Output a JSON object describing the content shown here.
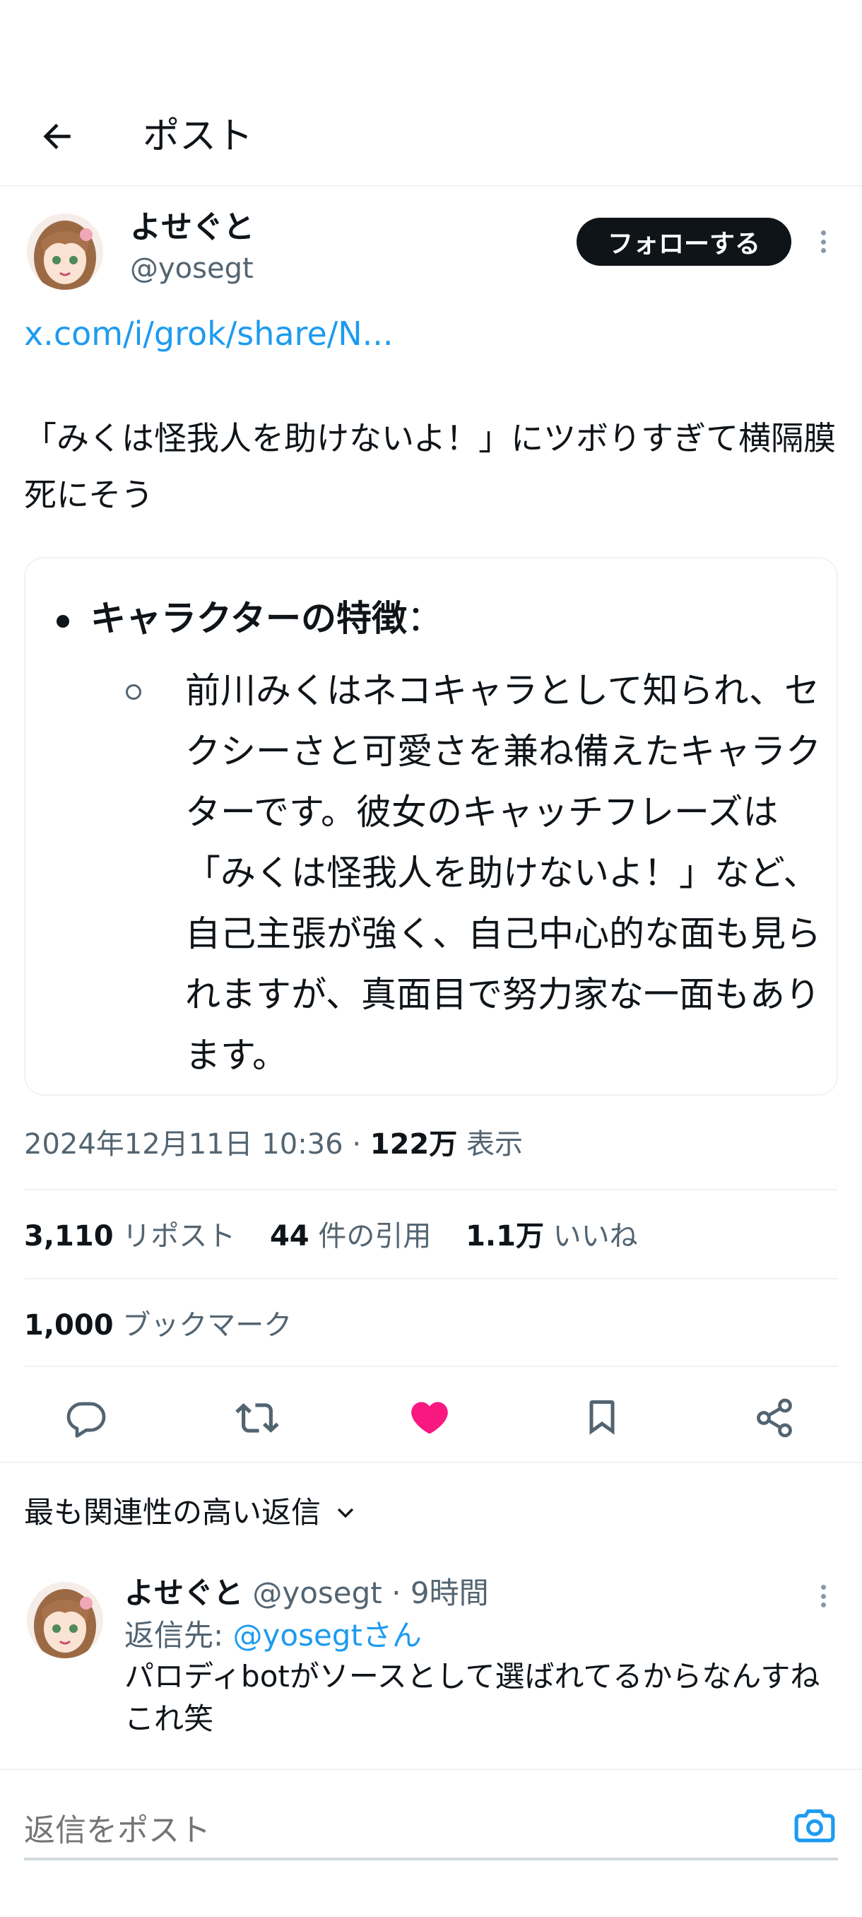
{
  "header": {
    "title": "ポスト"
  },
  "author": {
    "name": "よせぐと",
    "handle": "@yosegt",
    "follow_label": "フォローする"
  },
  "post": {
    "link": "x.com/i/grok/share/N...",
    "text": "「みくは怪我人を助けないよ！」にツボりすぎて横隔膜死にそう",
    "card": {
      "bullet_title": "キャラクターの特徴",
      "bullet_colon": "：",
      "sub_text": "前川みくはネコキャラとして知られ、セクシーさと可愛さを兼ね備えたキャラクターです。彼女のキャッチフレーズは「みくは怪我人を助けないよ！」など、自己主張が強く、自己中心的な面も見られますが、真面目で努力家な一面もあります。"
    },
    "timestamp": "2024年12月11日 10:36",
    "views_count": "122万",
    "views_label": "表示"
  },
  "stats": {
    "reposts_count": "3,110",
    "reposts_label": "リポスト",
    "quotes_count": "44",
    "quotes_label": "件の引用",
    "likes_count": "1.1万",
    "likes_label": "いいね",
    "bookmarks_count": "1,000",
    "bookmarks_label": "ブックマーク"
  },
  "actions": {
    "reply_icon": "comment-icon",
    "repost_icon": "repost-icon",
    "like_icon": "heart-filled-icon",
    "bookmark_icon": "bookmark-icon",
    "share_icon": "share-icon",
    "like_color": "#f91880"
  },
  "replies": {
    "sort_label": "最も関連性の高い返信",
    "items": [
      {
        "name": "よせぐと",
        "handle": "@yosegt",
        "time": "· 9時間",
        "reply_to_prefix": "返信先: ",
        "reply_to_mention": "@yosegtさん",
        "text": "パロディbotがソースとして選ばれてるからなんすねこれ笑"
      }
    ]
  },
  "compose": {
    "placeholder": "返信をポスト"
  },
  "colors": {
    "accent": "#1d9bf0",
    "text": "#0f1419",
    "muted": "#536471",
    "like": "#f91880"
  }
}
